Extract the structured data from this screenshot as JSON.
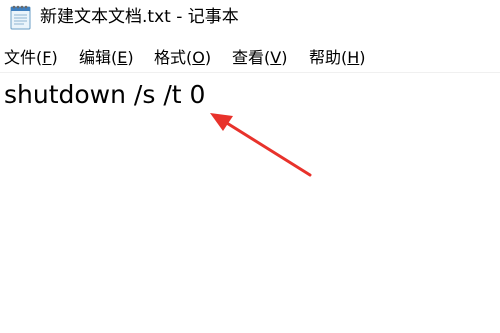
{
  "window": {
    "title": "新建文本文档.txt - 记事本"
  },
  "menu": {
    "items": [
      {
        "label": "文件",
        "mnemonic": "F"
      },
      {
        "label": "编辑",
        "mnemonic": "E"
      },
      {
        "label": "格式",
        "mnemonic": "O"
      },
      {
        "label": "查看",
        "mnemonic": "V"
      },
      {
        "label": "帮助",
        "mnemonic": "H"
      }
    ]
  },
  "editor": {
    "content": "shutdown /s /t 0"
  },
  "icons": {
    "app": "notepad-icon",
    "annotation": "red-arrow-icon"
  },
  "colors": {
    "annotation": "#e8322b"
  }
}
